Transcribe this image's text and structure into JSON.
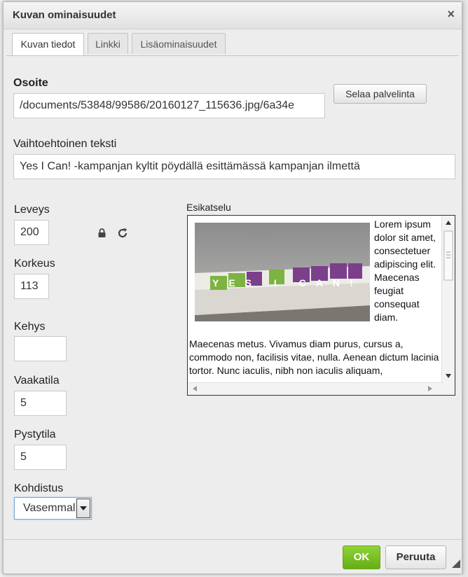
{
  "dialog": {
    "title": "Kuvan ominaisuudet",
    "close_label": "×"
  },
  "tabs": [
    {
      "label": "Kuvan tiedot",
      "active": true
    },
    {
      "label": "Linkki",
      "active": false
    },
    {
      "label": "Lisäominaisuudet",
      "active": false
    }
  ],
  "fields": {
    "url_label": "Osoite",
    "url_value": "/documents/53848/99586/20160127_115636.jpg/6a34e",
    "browse_button": "Selaa palvelinta",
    "alt_label": "Vaihtoehtoinen teksti",
    "alt_value": "Yes I Can! -kampanjan kyltit pöydällä esittämässä kampanjan ilmettä",
    "width_label": "Leveys",
    "width_value": "200",
    "height_label": "Korkeus",
    "height_value": "113",
    "border_label": "Kehys",
    "border_value": "",
    "hspace_label": "Vaakatila",
    "hspace_value": "5",
    "vspace_label": "Pystytila",
    "vspace_value": "5",
    "align_label": "Kohdistus",
    "align_value": "Vasemmalle"
  },
  "preview": {
    "label": "Esikatselu",
    "side_text": "Lorem ipsum dolor sit amet, consectetuer adipiscing elit. Maecenas feugiat consequat diam.",
    "bottom_text": "Maecenas metus. Vivamus diam purus, cursus a, commodo non, facilisis vitae, nulla. Aenean dictum lacinia tortor. Nunc iaculis, nibh non iaculis aliquam,",
    "image_sign_text": "YES I CAN!"
  },
  "footer": {
    "ok_label": "OK",
    "cancel_label": "Peruuta"
  },
  "colors": {
    "ok_green": "#66ad15",
    "sign_green": "#7cb342",
    "sign_purple": "#7b3f8c"
  },
  "icons": [
    "close-icon",
    "lock-icon",
    "reset-size-icon",
    "dropdown-arrow-icon",
    "resize-grip-icon"
  ]
}
